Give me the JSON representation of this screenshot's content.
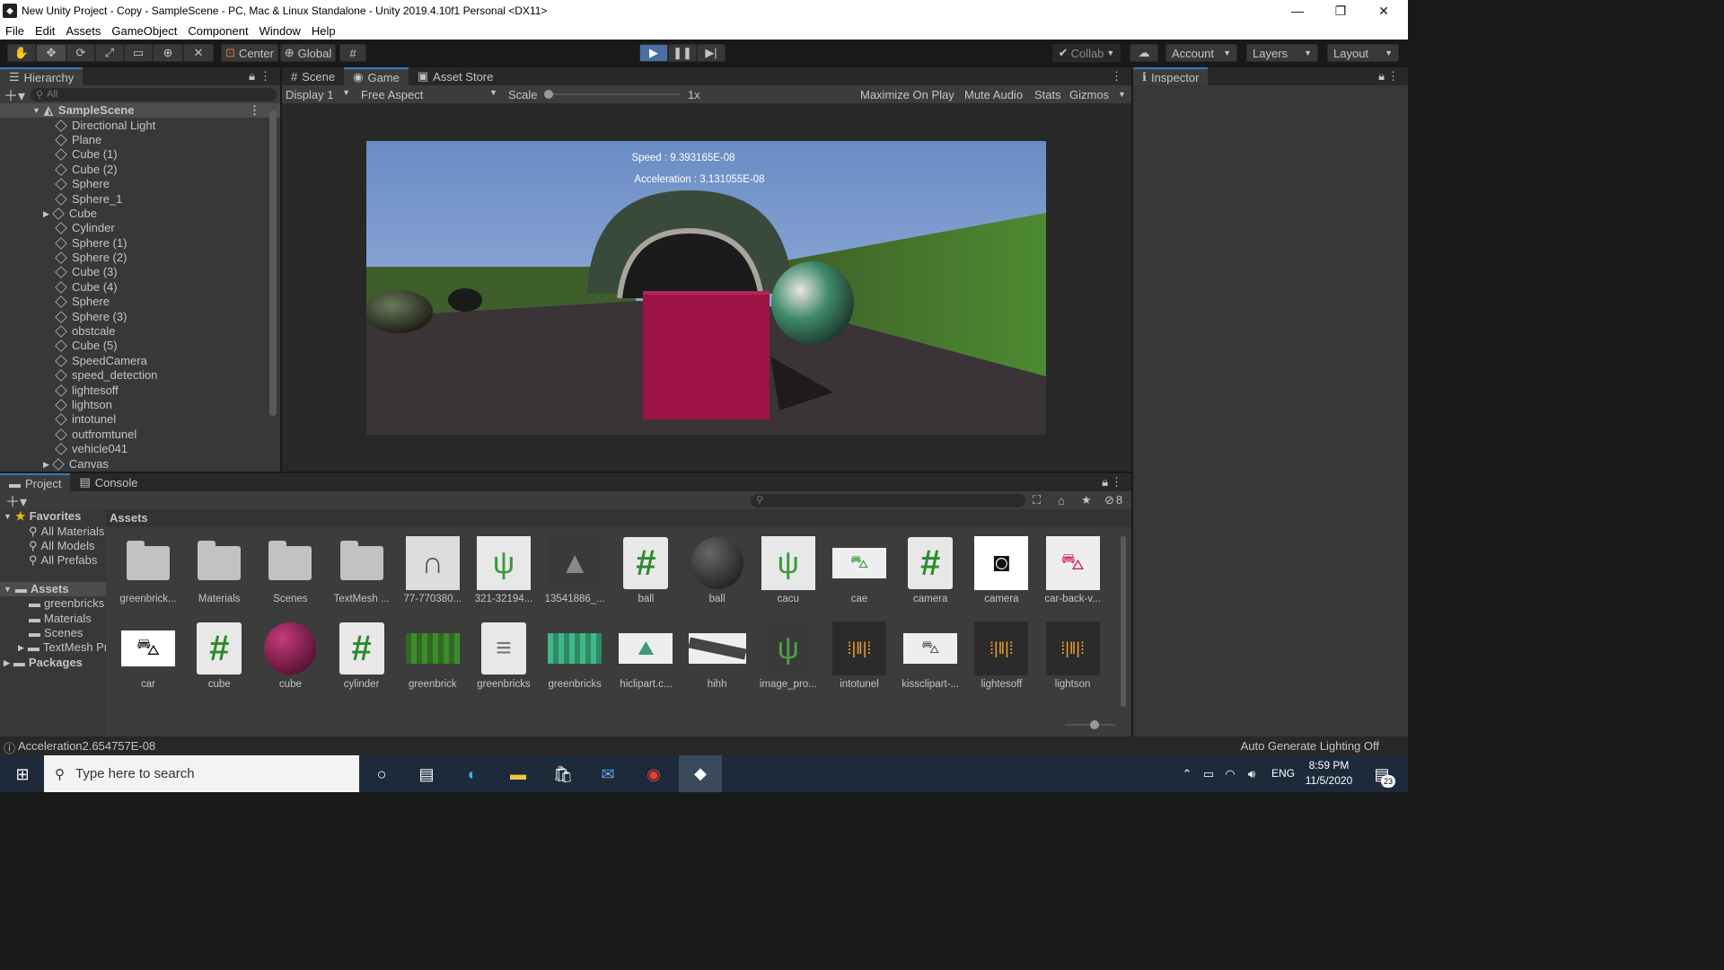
{
  "window": {
    "title": "New Unity Project - Copy - SampleScene - PC, Mac & Linux Standalone - Unity 2019.4.10f1 Personal <DX11>",
    "minimize": "—",
    "maximize": "❐",
    "close": "✕"
  },
  "menu": [
    "File",
    "Edit",
    "Assets",
    "GameObject",
    "Component",
    "Window",
    "Help"
  ],
  "toolbar": {
    "center_label": "Center",
    "global_label": "Global",
    "collab_label": "Collab",
    "account_label": "Account",
    "layers_label": "Layers",
    "layout_label": "Layout"
  },
  "hierarchy": {
    "tab": "Hierarchy",
    "search_placeholder": "All",
    "scene_name": "SampleScene",
    "items": [
      {
        "name": "Directional Light",
        "expand": false
      },
      {
        "name": "Plane",
        "expand": false
      },
      {
        "name": "Cube (1)",
        "expand": false
      },
      {
        "name": "Cube (2)",
        "expand": false
      },
      {
        "name": "Sphere",
        "expand": false
      },
      {
        "name": "Sphere_1",
        "expand": false
      },
      {
        "name": "Cube",
        "expand": true
      },
      {
        "name": "Cylinder",
        "expand": false
      },
      {
        "name": "Sphere (1)",
        "expand": false
      },
      {
        "name": "Sphere (2)",
        "expand": false
      },
      {
        "name": "Cube (3)",
        "expand": false
      },
      {
        "name": "Cube (4)",
        "expand": false
      },
      {
        "name": "Sphere",
        "expand": false
      },
      {
        "name": "Sphere (3)",
        "expand": false
      },
      {
        "name": "obstcale",
        "expand": false
      },
      {
        "name": "Cube (5)",
        "expand": false
      },
      {
        "name": "SpeedCamera",
        "expand": false
      },
      {
        "name": "speed_detection",
        "expand": false
      },
      {
        "name": "lightesoff",
        "expand": false
      },
      {
        "name": "lightson",
        "expand": false
      },
      {
        "name": "intotunel",
        "expand": false
      },
      {
        "name": "outfromtunel",
        "expand": false
      },
      {
        "name": "vehicle041",
        "expand": false
      },
      {
        "name": "Canvas",
        "expand": true
      }
    ]
  },
  "game_view": {
    "tabs": [
      "Scene",
      "Game",
      "Asset Store"
    ],
    "display": "Display 1",
    "aspect": "Free Aspect",
    "scale_label": "Scale",
    "scale_value": "1x",
    "buttons": [
      "Maximize On Play",
      "Mute Audio",
      "Stats",
      "Gizmos"
    ],
    "speed_text": "Speed : 9.393165E-08",
    "accel_text": "Acceleration : 3.131055E-08"
  },
  "inspector": {
    "tab": "Inspector"
  },
  "project": {
    "tabs": [
      "Project",
      "Console"
    ],
    "hidden_count": "8",
    "favorites_label": "Favorites",
    "favorites": [
      "All Materials",
      "All Models",
      "All Prefabs"
    ],
    "assets_label": "Assets",
    "asset_folders": [
      "greenbricks",
      "Materials",
      "Scenes",
      "TextMesh Pro"
    ],
    "packages_label": "Packages",
    "breadcrumb": "Assets",
    "row1": [
      {
        "label": "greenbrick...",
        "icon": "folder"
      },
      {
        "label": "Materials",
        "icon": "folder"
      },
      {
        "label": "Scenes",
        "icon": "folder"
      },
      {
        "label": "TextMesh ...",
        "icon": "folder"
      },
      {
        "label": "77-770380...",
        "icon": "tunnel-image"
      },
      {
        "label": "321-32194...",
        "icon": "cactus-image"
      },
      {
        "label": "13541886_...",
        "icon": "rock-image"
      },
      {
        "label": "ball",
        "icon": "script"
      },
      {
        "label": "ball",
        "icon": "black-sphere"
      },
      {
        "label": "cacu",
        "icon": "cactus-image"
      },
      {
        "label": "cae",
        "icon": "green-car-image"
      },
      {
        "label": "camera",
        "icon": "script"
      },
      {
        "label": "camera",
        "icon": "camera-image"
      },
      {
        "label": "car-back-v...",
        "icon": "red-car-image"
      }
    ],
    "row2": [
      {
        "label": "car",
        "icon": "black-car-image"
      },
      {
        "label": "cube",
        "icon": "script"
      },
      {
        "label": "cube",
        "icon": "magenta-sphere"
      },
      {
        "label": "cylinder",
        "icon": "script"
      },
      {
        "label": "greenbrick",
        "icon": "greenbrick-texture"
      },
      {
        "label": "greenbricks",
        "icon": "document"
      },
      {
        "label": "greenbricks",
        "icon": "greenbrick-texture-light"
      },
      {
        "label": "hiclipart.c...",
        "icon": "mountain-image"
      },
      {
        "label": "hihh",
        "icon": "road-image"
      },
      {
        "label": "image_pro...",
        "icon": "cactus-flower-image"
      },
      {
        "label": "intotunel",
        "icon": "audio"
      },
      {
        "label": "kissclipart-...",
        "icon": "car-front-image"
      },
      {
        "label": "lightesoff",
        "icon": "audio"
      },
      {
        "label": "lightson",
        "icon": "audio"
      }
    ]
  },
  "status": {
    "message": "Acceleration2.654757E-08",
    "right": "Auto Generate Lighting Off"
  },
  "taskbar": {
    "search_placeholder": "Type here to search",
    "language": "ENG",
    "time": "8:59 PM",
    "date": "11/5/2020",
    "notifications": "23"
  },
  "colors": {
    "editor_dark": "#191919",
    "panel": "#383838",
    "accent_blue": "#3a79bb",
    "sky": "#7ea0cf",
    "cube": "#9e1346"
  }
}
